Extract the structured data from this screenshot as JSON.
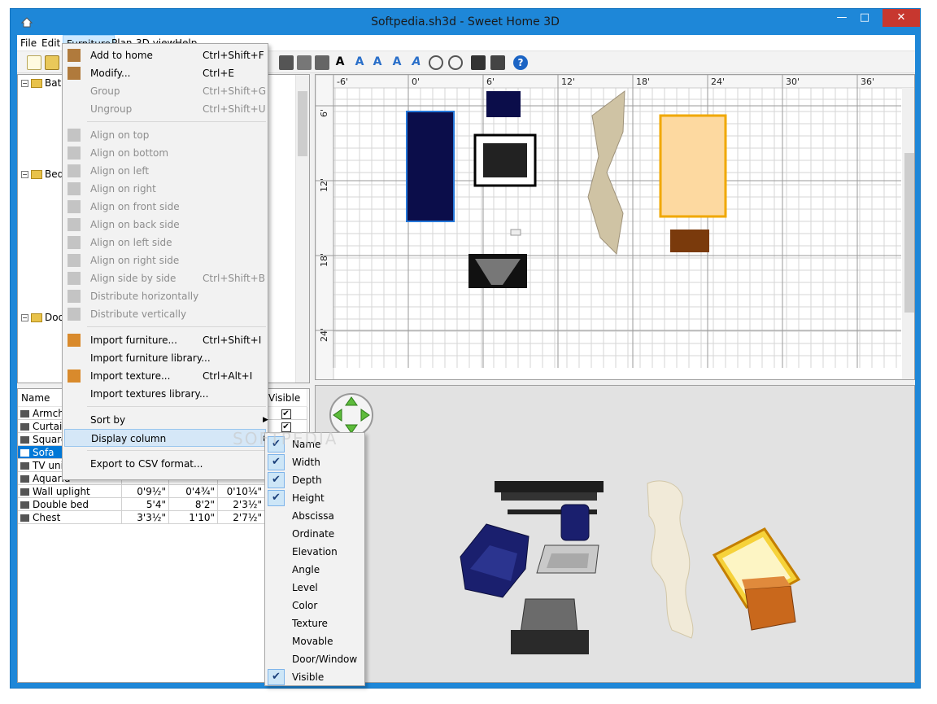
{
  "window": {
    "title": "Softpedia.sh3d - Sweet Home 3D"
  },
  "menubar": [
    "File",
    "Edit",
    "Furniture",
    "Plan",
    "3D view",
    "Help"
  ],
  "catalog": {
    "rows": [
      {
        "label": "Bat",
        "type": "folder"
      },
      {
        "label": "Bed",
        "type": "folder"
      },
      {
        "label": "Doo",
        "type": "folder"
      }
    ]
  },
  "table": {
    "headers": [
      "Name",
      "Visible"
    ],
    "rows": [
      {
        "name": "Armcha",
        "width": "",
        "depth": "",
        "height": "",
        "visible": true,
        "selected": false
      },
      {
        "name": "Curtain",
        "width": "",
        "depth": "",
        "height": "",
        "visible": true,
        "selected": false
      },
      {
        "name": "Square",
        "width": "",
        "depth": "",
        "height": "",
        "visible": true,
        "selected": false
      },
      {
        "name": "Sofa",
        "width": "",
        "depth": "",
        "height": "",
        "visible": true,
        "selected": true
      },
      {
        "name": "TV unit",
        "width": "",
        "depth": "",
        "height": "",
        "visible": true,
        "selected": false
      },
      {
        "name": "Aquariu",
        "width": "",
        "depth": "",
        "height": "",
        "visible": true,
        "selected": false
      },
      {
        "name": "Wall uplight",
        "width": "0'9½\"",
        "depth": "0'4¾\"",
        "height": "0'10¼\"",
        "visible": false,
        "selected": false
      },
      {
        "name": "Double bed",
        "width": "5'4\"",
        "depth": "8'2\"",
        "height": "2'3½\"",
        "visible": false,
        "selected": false
      },
      {
        "name": "Chest",
        "width": "3'3½\"",
        "depth": "1'10\"",
        "height": "2'7½\"",
        "visible": false,
        "selected": false
      }
    ]
  },
  "plan": {
    "ruler_x": [
      "-6'",
      "0'",
      "6'",
      "12'",
      "18'",
      "24'",
      "30'",
      "36'"
    ],
    "ruler_y": [
      "6'",
      "12'",
      "18'",
      "24'"
    ]
  },
  "furniture_menu": {
    "items": [
      {
        "label": "Add to home",
        "shortcut": "Ctrl+Shift+F",
        "enabled": true,
        "icon": "add-furniture-icon"
      },
      {
        "label": "Modify...",
        "shortcut": "Ctrl+E",
        "enabled": true,
        "icon": "modify-icon"
      },
      {
        "label": "Group",
        "shortcut": "Ctrl+Shift+G",
        "enabled": false
      },
      {
        "label": "Ungroup",
        "shortcut": "Ctrl+Shift+U",
        "enabled": false
      },
      {
        "sep": true
      },
      {
        "label": "Align on top",
        "shortcut": "",
        "enabled": false,
        "icon": "align-top-icon"
      },
      {
        "label": "Align on bottom",
        "shortcut": "",
        "enabled": false,
        "icon": "align-bottom-icon"
      },
      {
        "label": "Align on left",
        "shortcut": "",
        "enabled": false,
        "icon": "align-left-icon"
      },
      {
        "label": "Align on right",
        "shortcut": "",
        "enabled": false,
        "icon": "align-right-icon"
      },
      {
        "label": "Align on front side",
        "shortcut": "",
        "enabled": false,
        "icon": "align-front-icon"
      },
      {
        "label": "Align on back side",
        "shortcut": "",
        "enabled": false,
        "icon": "align-back-icon"
      },
      {
        "label": "Align on left side",
        "shortcut": "",
        "enabled": false,
        "icon": "align-left-side-icon"
      },
      {
        "label": "Align on right side",
        "shortcut": "",
        "enabled": false,
        "icon": "align-right-side-icon"
      },
      {
        "label": "Align side by side",
        "shortcut": "Ctrl+Shift+B",
        "enabled": false,
        "icon": "align-side-by-side-icon"
      },
      {
        "label": "Distribute horizontally",
        "shortcut": "",
        "enabled": false,
        "icon": "distribute-horizontal-icon"
      },
      {
        "label": "Distribute vertically",
        "shortcut": "",
        "enabled": false,
        "icon": "distribute-vertical-icon"
      },
      {
        "sep": true
      },
      {
        "label": "Import furniture...",
        "shortcut": "Ctrl+Shift+I",
        "enabled": true,
        "icon": "import-furniture-icon"
      },
      {
        "label": "Import furniture library...",
        "shortcut": "",
        "enabled": true
      },
      {
        "label": "Import texture...",
        "shortcut": "Ctrl+Alt+I",
        "enabled": true,
        "icon": "import-texture-icon"
      },
      {
        "label": "Import textures library...",
        "shortcut": "",
        "enabled": true
      },
      {
        "sep": true
      },
      {
        "label": "Sort by",
        "shortcut": "",
        "enabled": true,
        "submenu": true
      },
      {
        "label": "Display column",
        "shortcut": "",
        "enabled": true,
        "submenu": true,
        "highlighted": true
      },
      {
        "sep": true
      },
      {
        "label": "Export to CSV format...",
        "shortcut": "",
        "enabled": true
      }
    ]
  },
  "display_column_menu": {
    "items": [
      {
        "label": "Name",
        "checked": true
      },
      {
        "label": "Width",
        "checked": true
      },
      {
        "label": "Depth",
        "checked": true
      },
      {
        "label": "Height",
        "checked": true
      },
      {
        "label": "Abscissa",
        "checked": false
      },
      {
        "label": "Ordinate",
        "checked": false
      },
      {
        "label": "Elevation",
        "checked": false
      },
      {
        "label": "Angle",
        "checked": false
      },
      {
        "label": "Level",
        "checked": false
      },
      {
        "label": "Color",
        "checked": false
      },
      {
        "label": "Texture",
        "checked": false
      },
      {
        "label": "Movable",
        "checked": false
      },
      {
        "label": "Door/Window",
        "checked": false
      },
      {
        "label": "Visible",
        "checked": true
      }
    ]
  },
  "watermark": "SOFTPEDIA",
  "colors": {
    "accent": "#0078d7",
    "titlebar": "#1e87d8",
    "close": "#c7372f"
  }
}
